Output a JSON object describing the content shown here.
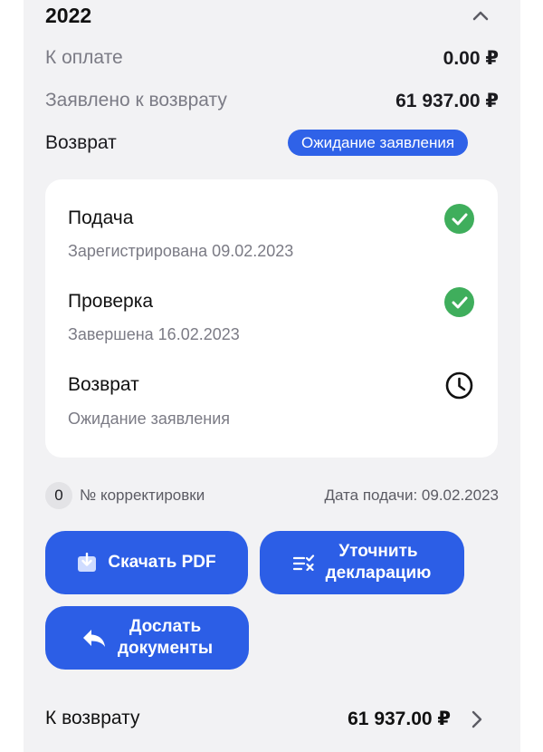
{
  "header": {
    "year": "2022",
    "collapse_icon": "chevron-up-icon"
  },
  "summary": {
    "to_pay_label": "К оплате",
    "to_pay_value": "0.00 ₽",
    "claimed_label": "Заявлено к возврату",
    "claimed_value": "61 937.00 ₽",
    "refund_label": "Возврат",
    "refund_status": "Ожидание заявления"
  },
  "steps": [
    {
      "title": "Подача",
      "subtitle": "Зарегистрирована 09.02.2023",
      "icon": "check-icon",
      "status": "done"
    },
    {
      "title": "Проверка",
      "subtitle": "Завершена 16.02.2023",
      "icon": "check-icon",
      "status": "done"
    },
    {
      "title": "Возврат",
      "subtitle": "Ожидание заявления",
      "icon": "clock-icon",
      "status": "pending"
    }
  ],
  "meta": {
    "correction_number": "0",
    "correction_label": "№ корректировки",
    "submission_date": "Дата подачи: 09.02.2023"
  },
  "actions": {
    "download_pdf": "Скачать PDF",
    "clarify_line1": "Уточнить",
    "clarify_line2": "декларацию",
    "send_line1": "Дослать",
    "send_line2": "документы"
  },
  "footer": {
    "refund_label": "К возврату",
    "refund_value": "61 937.00 ₽",
    "chevron_icon": "chevron-right-icon"
  },
  "colors": {
    "accent": "#2c5ee6",
    "success": "#3fae5c",
    "card_bg": "#f2f2f4"
  }
}
